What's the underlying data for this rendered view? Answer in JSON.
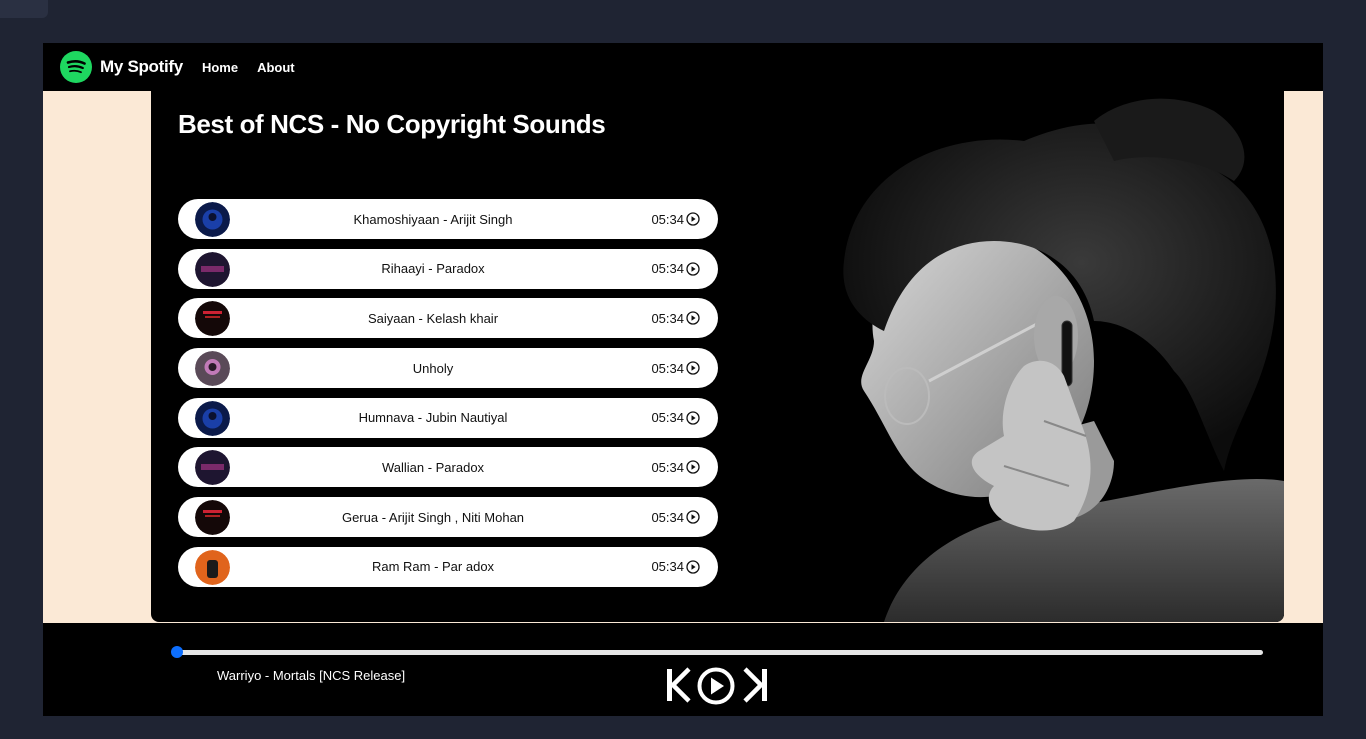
{
  "navbar": {
    "brand": "My Spotify",
    "links": [
      "Home",
      "About"
    ],
    "logo_icon": "spotify-logo-icon"
  },
  "playlist": {
    "title": "Best of NCS - No Copyright Sounds",
    "songs": [
      {
        "name": "Khamoshiyaan - Arijit Singh",
        "duration": "05:34",
        "cover_color": "#1a3fa8"
      },
      {
        "name": "Rihaayi - Paradox",
        "duration": "05:34",
        "cover_color": "#2a1a3a"
      },
      {
        "name": "Saiyaan - Kelash khair",
        "duration": "05:34",
        "cover_color": "#1a0d0d"
      },
      {
        "name": "Unholy",
        "duration": "05:34",
        "cover_color": "#8a6a86"
      },
      {
        "name": "Humnava - Jubin Nautiyal",
        "duration": "05:34",
        "cover_color": "#1a3fa8"
      },
      {
        "name": "Wallian - Paradox",
        "duration": "05:34",
        "cover_color": "#2a1a3a"
      },
      {
        "name": "Gerua - Arijit Singh , Niti Mohan",
        "duration": "05:34",
        "cover_color": "#1a0d0d"
      },
      {
        "name": "Ram Ram - Par adox",
        "duration": "05:34",
        "cover_color": "#e0641c"
      }
    ]
  },
  "player": {
    "now_playing": "Warriyo - Mortals [NCS Release]",
    "progress": 0,
    "accent": "#0d6efd",
    "icons": [
      "skip-previous-icon",
      "play-circle-icon",
      "skip-next-icon"
    ]
  }
}
